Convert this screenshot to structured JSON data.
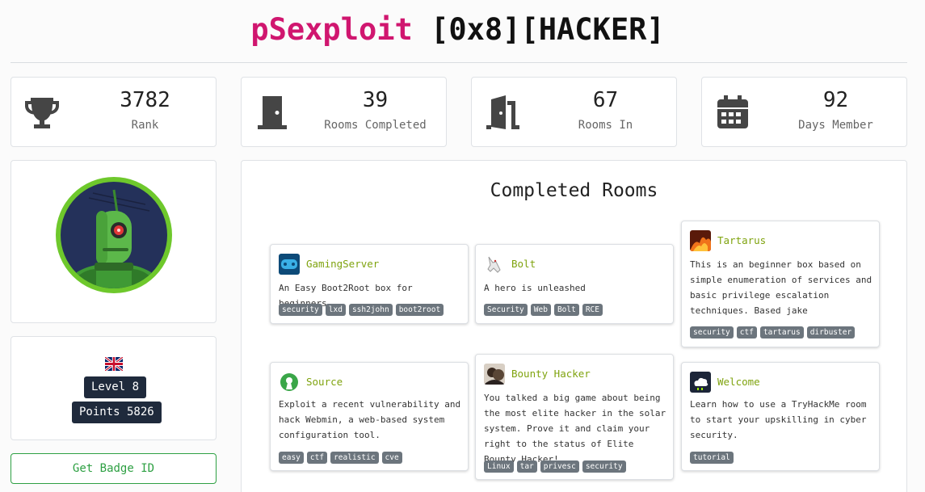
{
  "header": {
    "username": "pSexploit",
    "tags": "[0x8][HACKER]"
  },
  "stats": [
    {
      "value": "3782",
      "label": "Rank",
      "icon": "trophy-icon"
    },
    {
      "value": "39",
      "label": "Rooms Completed",
      "icon": "door-closed-icon"
    },
    {
      "value": "67",
      "label": "Rooms In",
      "icon": "door-open-icon"
    },
    {
      "value": "92",
      "label": "Days Member",
      "icon": "calendar-icon"
    }
  ],
  "profile": {
    "level": "Level 8",
    "points": "Points 5826",
    "badge_button": "Get Badge ID"
  },
  "rooms": {
    "title": "Completed Rooms",
    "items": [
      {
        "name": "GamingServer",
        "description": "An Easy Boot2Root box for beginners",
        "tags": [
          "security",
          "lxd",
          "ssh2john",
          "boot2root"
        ]
      },
      {
        "name": "Bolt",
        "description": "A hero is unleashed",
        "tags": [
          "Security",
          "Web",
          "Bolt",
          "RCE"
        ]
      },
      {
        "name": "Tartarus",
        "description": "This is an beginner box based on simple enumeration of services and basic privilege escalation techniques. Based jake",
        "tags": [
          "security",
          "ctf",
          "tartarus",
          "dirbuster"
        ]
      },
      {
        "name": "Source",
        "description": "Exploit a recent vulnerability and hack Webmin, a web-based system configuration tool.",
        "tags": [
          "easy",
          "ctf",
          "realistic",
          "cve"
        ]
      },
      {
        "name": "Bounty Hacker",
        "description": "You talked a big game about being the most elite hacker in the solar system. Prove it and claim your right to the status of Elite Bounty Hacker!",
        "tags": [
          "Linux",
          "tar",
          "privesc",
          "security"
        ]
      },
      {
        "name": "Welcome",
        "description": "Learn how to use a TryHackMe room to start your upskilling in cyber security.",
        "tags": [
          "tutorial"
        ]
      }
    ]
  },
  "colors": {
    "username": "#d0166f",
    "room_name": "#7fa30e",
    "badge_button": "#2ea043",
    "pill": "#1f2a3c",
    "tag": "#6c757d"
  }
}
